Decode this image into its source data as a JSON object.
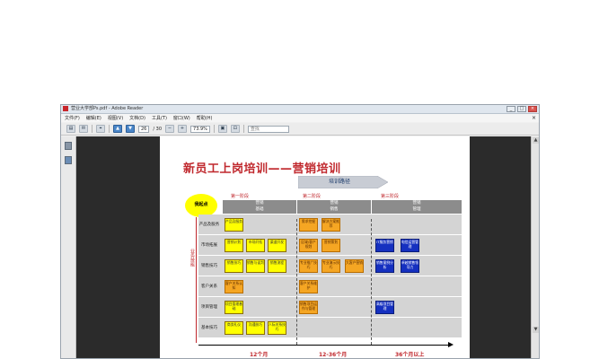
{
  "window": {
    "title": "营业大学部Ps.pdf - Adobe Reader",
    "controls": [
      "_",
      "□",
      "×"
    ]
  },
  "menu": {
    "items": [
      "文件(F)",
      "编辑(E)",
      "视图(V)",
      "文档(D)",
      "工具(T)",
      "窗口(W)",
      "帮助(H)"
    ],
    "close": "×"
  },
  "toolbar": {
    "page_current": "26",
    "page_total": "/ 30",
    "zoom": "73.9%",
    "find_placeholder": "查找"
  },
  "slide": {
    "title": "新员工上岗培训——营销培训",
    "path_label": "培训路径",
    "start_label": "我起点",
    "stages": [
      "第一阶段",
      "第二阶段",
      "第三阶段"
    ],
    "headers": [
      {
        "top": "营销",
        "bottom": "基础"
      },
      {
        "top": "营销",
        "bottom": "销售"
      },
      {
        "top": "营销",
        "bottom": "管理"
      }
    ],
    "side_label": "业务技能",
    "rows": [
      {
        "label": "产品及服务"
      },
      {
        "label": "市场拓展"
      },
      {
        "label": "销售技巧"
      },
      {
        "label": "客户关系"
      },
      {
        "label": "项目管理"
      },
      {
        "label": "基本技巧"
      }
    ],
    "cells": [
      {
        "row": 0,
        "col": 0,
        "text": "产品及服务",
        "color": "y"
      },
      {
        "row": 0,
        "col": 3,
        "text": "需求挖掘",
        "color": "o"
      },
      {
        "row": 0,
        "col": 4,
        "text": "解决方案推荐",
        "color": "o"
      },
      {
        "row": 1,
        "col": 0,
        "text": "营销计划",
        "color": "y"
      },
      {
        "row": 1,
        "col": 1,
        "text": "市场开拓",
        "color": "y"
      },
      {
        "row": 1,
        "col": 2,
        "text": "渠道开发",
        "color": "y"
      },
      {
        "row": 1,
        "col": 3,
        "text": "区域/客户规划",
        "color": "o"
      },
      {
        "row": 1,
        "col": 4,
        "text": "营销策划",
        "color": "o"
      },
      {
        "row": 1,
        "col": 6,
        "text": "IT服务营销",
        "color": "b"
      },
      {
        "row": 1,
        "col": 7,
        "text": "电信运营管理",
        "color": "b"
      },
      {
        "row": 2,
        "col": 0,
        "text": "销售技巧",
        "color": "y"
      },
      {
        "row": 2,
        "col": 1,
        "text": "销售与谈判",
        "color": "y"
      },
      {
        "row": 2,
        "col": 2,
        "text": "销售流程",
        "color": "y"
      },
      {
        "row": 2,
        "col": 3,
        "text": "专业推广技巧",
        "color": "o"
      },
      {
        "row": 2,
        "col": 4,
        "text": "专业演示技巧",
        "color": "o"
      },
      {
        "row": 2,
        "col": 5,
        "text": "大客户营销",
        "color": "o"
      },
      {
        "row": 2,
        "col": 6,
        "text": "销售案例分析",
        "color": "b"
      },
      {
        "row": 2,
        "col": 7,
        "text": "卓越销售领导力",
        "color": "b"
      },
      {
        "row": 3,
        "col": 0,
        "text": "客户关系认知",
        "color": "o"
      },
      {
        "row": 3,
        "col": 3,
        "text": "客户关系维护",
        "color": "o"
      },
      {
        "row": 4,
        "col": 0,
        "text": "项目管理基础",
        "color": "y"
      },
      {
        "row": 4,
        "col": 3,
        "text": "销售项目运作与管理",
        "color": "o"
      },
      {
        "row": 4,
        "col": 6,
        "text": "高级项目管理",
        "color": "b"
      },
      {
        "row": 5,
        "col": 0,
        "text": "商务礼仪",
        "color": "y"
      },
      {
        "row": 5,
        "col": 1,
        "text": "沟通技巧",
        "color": "y"
      },
      {
        "row": 5,
        "col": 2,
        "text": "人际关系技巧",
        "color": "y"
      }
    ],
    "axis_labels": [
      "12个月",
      "12-36个月",
      "36个月以上"
    ]
  }
}
